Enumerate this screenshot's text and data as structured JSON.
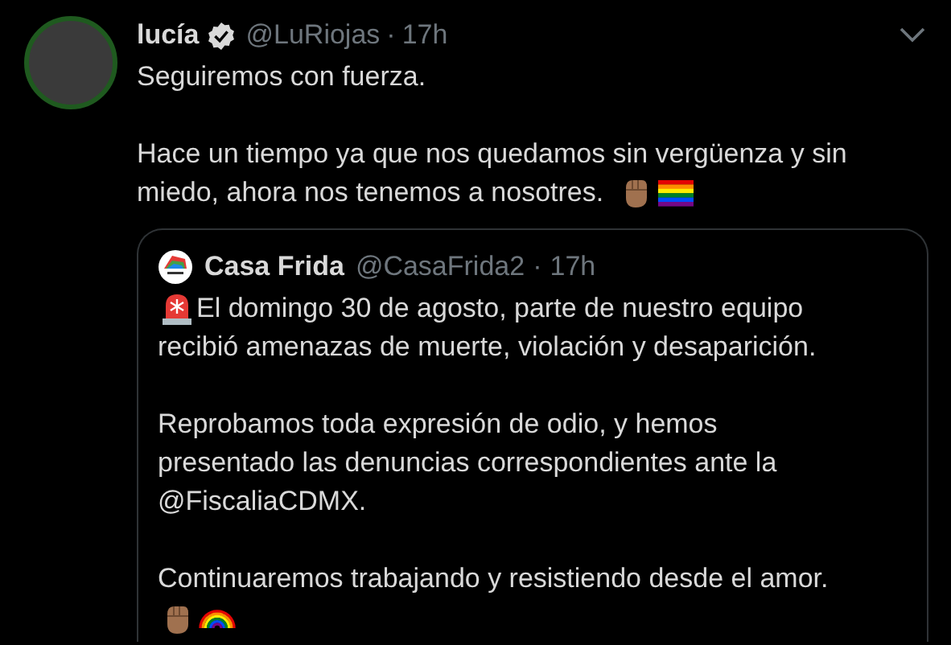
{
  "tweet": {
    "name": "lucía",
    "verified": true,
    "handle": "@LuRiojas",
    "separator": "·",
    "time": "17h",
    "paragraphs": [
      {
        "lines": [
          "Seguiremos con fuerza."
        ]
      },
      {
        "lines": [
          "Hace un tiempo ya que nos quedamos sin vergüenza y sin",
          "miedo, ahora nos tenemos a nosotres."
        ],
        "trail_emoji": [
          {
            "kind": "fist"
          },
          {
            "kind": "rainbow-flag"
          }
        ]
      }
    ]
  },
  "quoted": {
    "name": "Casa Frida",
    "handle": "@CasaFrida2",
    "separator": "·",
    "time": "17h",
    "paragraphs": [
      {
        "lines": [
          "El domingo 30 de agosto, parte de nuestro equipo",
          "recibió amenazas de muerte, violación y desaparición."
        ],
        "lead_emoji": [
          {
            "kind": "siren"
          }
        ]
      },
      {
        "lines": [
          "Reprobamos toda expresión de odio, y hemos",
          "presentado las denuncias correspondientes ante la",
          "@FiscaliaCDMX."
        ]
      },
      {
        "lines": [
          "Continuaremos trabajando y resistiendo desde el amor."
        ],
        "emoji_line": [
          {
            "kind": "fist"
          },
          {
            "kind": "rainbow"
          }
        ]
      }
    ]
  }
}
